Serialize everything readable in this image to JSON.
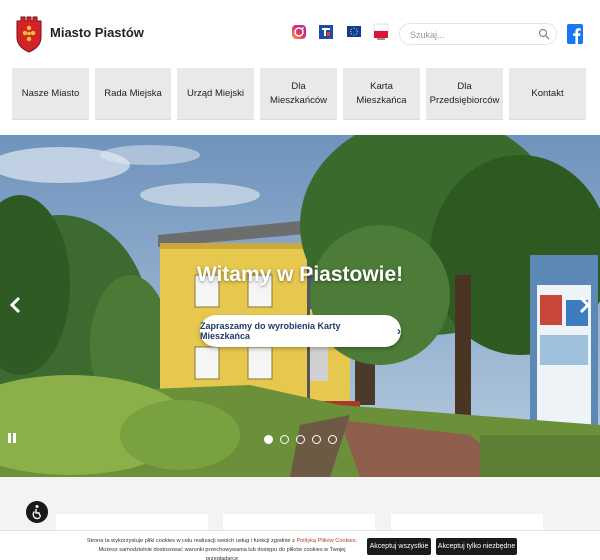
{
  "header": {
    "site_title": "Miasto Piastów",
    "search_placeholder": "Szukaj...",
    "social": [
      "instagram-icon",
      "bip-icon",
      "eu-flag-icon",
      "poland-flag-icon"
    ]
  },
  "nav": {
    "items": [
      {
        "label": "Nasze Miasto"
      },
      {
        "label": "Rada Miejska"
      },
      {
        "label": "Urząd Miejski"
      },
      {
        "label": "Dla Mieszkańców"
      },
      {
        "label": "Karta Mieszkańca"
      },
      {
        "label": "Dla Przedsiębiorców"
      },
      {
        "label": "Kontakt"
      }
    ]
  },
  "hero": {
    "title": "Witamy w Piastowie!",
    "cta_label": "Zapraszamy do wyrobienia Karty Mieszkańca",
    "cta_arrow": "›",
    "slides": 5,
    "active_slide": 1
  },
  "cookie": {
    "text_before": "Strona ta wykorzystuje pliki cookies w celu realizacji swoich usług i funkcji zgodnie z ",
    "link_label": "Polityką Plików Cookies",
    "text_after": ". Możesz samodzielnie dostosować warunki przechowywania lub dostępu do plików cookies w Twojej przeglądarce",
    "accept_all_label": "Akceptuj wszystkie",
    "accept_necessary_label": "Akceptuj tylko niezbędne"
  },
  "colors": {
    "accent": "#1f3a6b",
    "facebook": "#1877f2",
    "crest_red": "#d3232a",
    "crest_gold": "#f2c231"
  }
}
